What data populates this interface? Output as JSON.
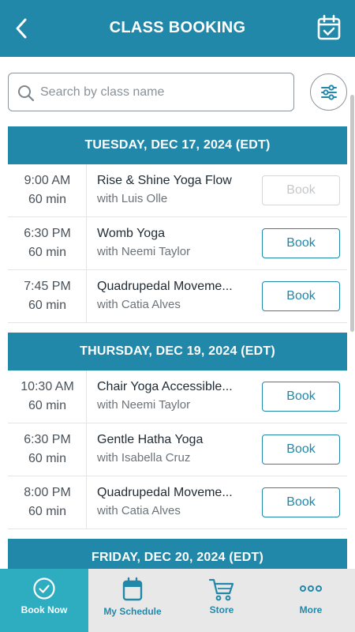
{
  "header": {
    "title": "CLASS BOOKING",
    "back_icon": "chevron-left-icon",
    "calendar_icon": "calendar-check-icon"
  },
  "search": {
    "placeholder": "Search by class name",
    "value": ""
  },
  "days": [
    {
      "label": "TUESDAY, DEC 17, 2024 (EDT)",
      "classes": [
        {
          "time": "9:00  AM",
          "duration": "60 min",
          "name": "Rise & Shine Yoga Flow",
          "instructor": "with Luis Olle",
          "book": "Book",
          "enabled": false
        },
        {
          "time": "6:30  PM",
          "duration": "60 min",
          "name": "Womb Yoga",
          "instructor": "with Neemi Taylor",
          "book": "Book",
          "enabled": true
        },
        {
          "time": "7:45  PM",
          "duration": "60 min",
          "name": "Quadrupedal Moveme...",
          "instructor": "with Catia Alves",
          "book": "Book",
          "enabled": true
        }
      ]
    },
    {
      "label": "THURSDAY, DEC 19, 2024 (EDT)",
      "classes": [
        {
          "time": "10:30  AM",
          "duration": "60 min",
          "name": "Chair Yoga Accessible...",
          "instructor": "with Neemi Taylor",
          "book": "Book",
          "enabled": true
        },
        {
          "time": "6:30  PM",
          "duration": "60 min",
          "name": "Gentle Hatha Yoga",
          "instructor": "with Isabella Cruz",
          "book": "Book",
          "enabled": true
        },
        {
          "time": "8:00  PM",
          "duration": "60 min",
          "name": "Quadrupedal Moveme...",
          "instructor": "with Catia Alves",
          "book": "Book",
          "enabled": true
        }
      ]
    },
    {
      "label": "FRIDAY, DEC 20, 2024 (EDT)",
      "classes": []
    }
  ],
  "tabs": [
    {
      "label": "Book Now",
      "icon": "check-circle-icon",
      "active": true
    },
    {
      "label": "My Schedule",
      "icon": "calendar-icon",
      "active": false
    },
    {
      "label": "Store",
      "icon": "cart-icon",
      "active": false
    },
    {
      "label": "More",
      "icon": "more-dots-icon",
      "active": false
    }
  ],
  "colors": {
    "primary": "#2188a9",
    "active_tab": "#2eacc0",
    "tabbar_bg": "#e8e8e8"
  }
}
